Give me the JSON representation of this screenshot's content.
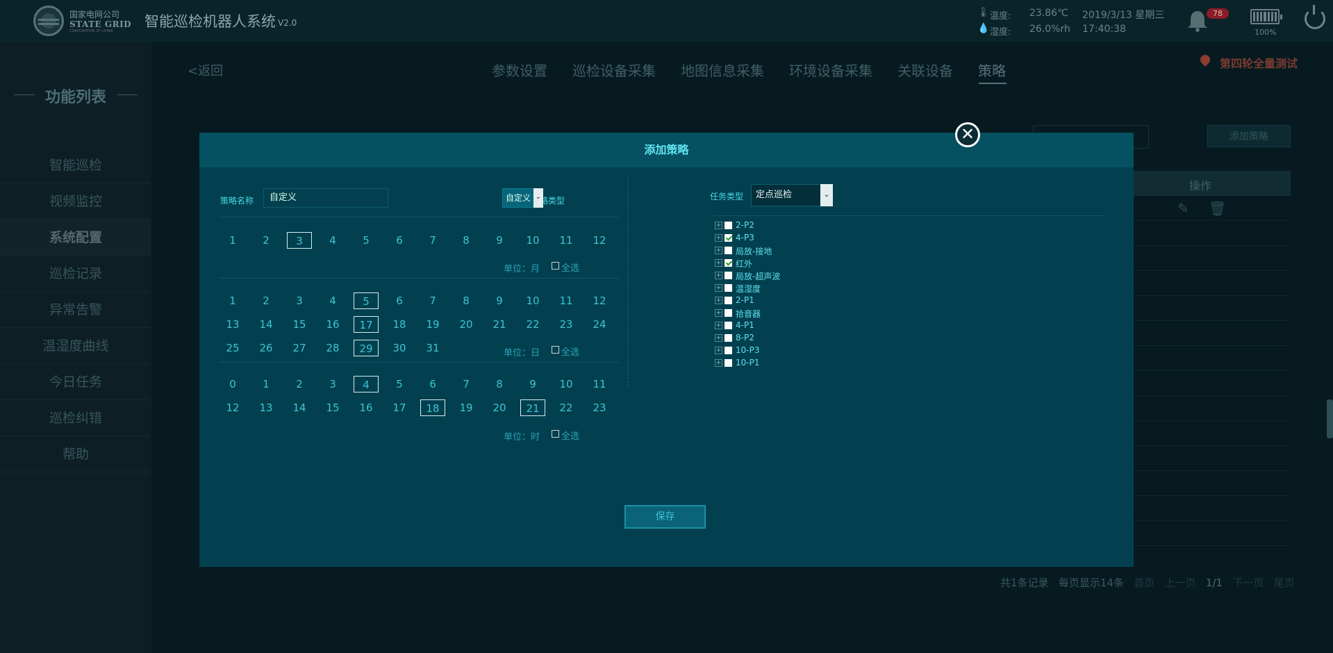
{
  "header": {
    "company_cn": "国家电网公司",
    "company_en": "STATE GRID",
    "company_sub": "CORPORATION OF CHINA",
    "system_title": "智能巡检机器人系统",
    "system_version": "V2.0",
    "temperature_label": "温度:",
    "temperature_value": "23.86℃",
    "humidity_label": "湿度:",
    "humidity_value": "26.0%rh",
    "date": "2019/3/13 星期三",
    "time": "17:40:38",
    "alarm_count": "78",
    "battery_percent": "100%",
    "battery_level": 1.0
  },
  "sidebar": {
    "title": "功能列表",
    "items": [
      {
        "label": "智能巡检"
      },
      {
        "label": "视频监控"
      },
      {
        "label": "系统配置"
      },
      {
        "label": "巡检记录"
      },
      {
        "label": "异常告警"
      },
      {
        "label": "温湿度曲线"
      },
      {
        "label": "今日任务"
      },
      {
        "label": "巡检纠错"
      },
      {
        "label": "帮助"
      }
    ]
  },
  "nav": {
    "back": "<返回",
    "tabs": [
      "参数设置",
      "巡检设备采集",
      "地图信息采集",
      "环境设备采集",
      "关联设备",
      "策略"
    ],
    "active_tab": "策略",
    "location": "第四轮全量测试"
  },
  "background": {
    "add_button": "添加策略",
    "op_header": "操作",
    "pager": {
      "total": "共1条记录",
      "per_page": "每页显示14条",
      "first": "首页",
      "prev": "上一页",
      "current": "1/1",
      "next": "下一页",
      "last": "尾页"
    }
  },
  "modal": {
    "title": "添加策略",
    "name_label": "策略名称",
    "name_value": "自定义",
    "type_label": "策略类型",
    "type_value": "自定义",
    "months": [
      "1",
      "2",
      "3",
      "4",
      "5",
      "6",
      "7",
      "8",
      "9",
      "10",
      "11",
      "12"
    ],
    "months_selected": [
      "3"
    ],
    "months_unit": "单位：月",
    "days": [
      "1",
      "2",
      "3",
      "4",
      "5",
      "6",
      "7",
      "8",
      "9",
      "10",
      "11",
      "12",
      "13",
      "14",
      "15",
      "16",
      "17",
      "18",
      "19",
      "20",
      "21",
      "22",
      "23",
      "24",
      "25",
      "26",
      "27",
      "28",
      "29",
      "30",
      "31"
    ],
    "days_selected": [
      "5",
      "17",
      "29"
    ],
    "days_unit": "单位：日",
    "hours": [
      "0",
      "1",
      "2",
      "3",
      "4",
      "5",
      "6",
      "7",
      "8",
      "9",
      "10",
      "11",
      "12",
      "13",
      "14",
      "15",
      "16",
      "17",
      "18",
      "19",
      "20",
      "21",
      "22",
      "23"
    ],
    "hours_selected": [
      "4",
      "18",
      "21"
    ],
    "hours_unit": "单位：时",
    "select_all": "全选",
    "task_type_label": "任务类型",
    "task_type_value": "定点巡检",
    "tree": [
      {
        "label": "2-P2",
        "checked": false
      },
      {
        "label": "4-P3",
        "checked": true
      },
      {
        "label": "局放-接地",
        "checked": false
      },
      {
        "label": "红外",
        "checked": true
      },
      {
        "label": "局放-超声波",
        "checked": false
      },
      {
        "label": "温湿度",
        "checked": false
      },
      {
        "label": "2-P1",
        "checked": false
      },
      {
        "label": "拾音器",
        "checked": false
      },
      {
        "label": "4-P1",
        "checked": false
      },
      {
        "label": "8-P2",
        "checked": false
      },
      {
        "label": "10-P3",
        "checked": false
      },
      {
        "label": "10-P1",
        "checked": false
      }
    ],
    "save": "保存"
  }
}
